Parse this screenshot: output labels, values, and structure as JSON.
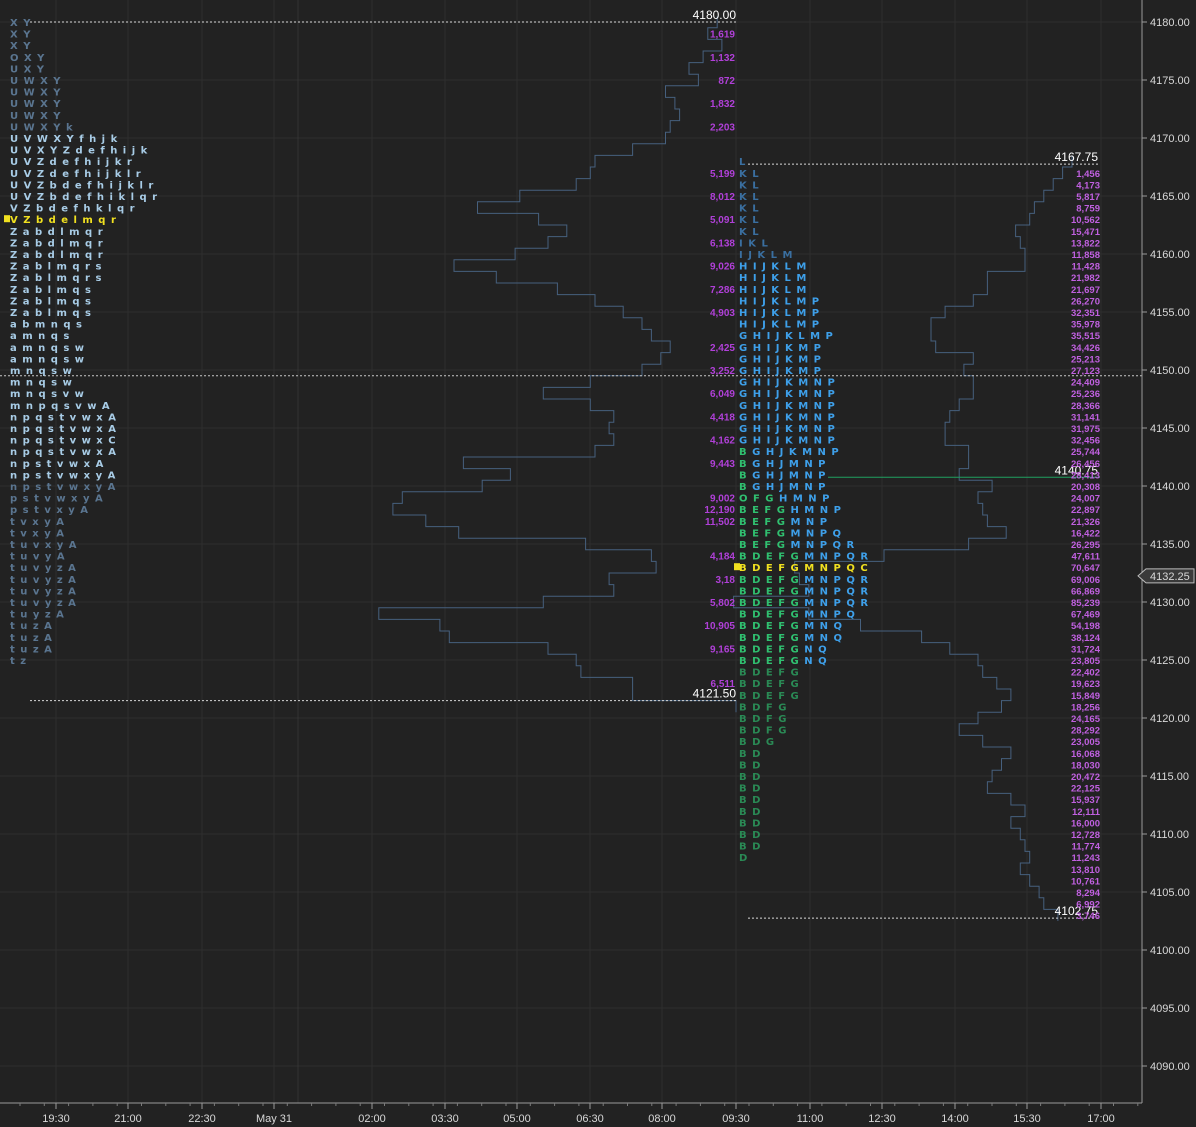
{
  "chart_data": {
    "type": "market-profile",
    "y_axis": {
      "range": [
        4086,
        4182
      ],
      "ticks": [
        "4180.00",
        "4175.00",
        "4170.00",
        "4165.00",
        "4160.00",
        "4155.00",
        "4150.00",
        "4145.00",
        "4140.00",
        "4135.00",
        "4130.00",
        "4125.00",
        "4120.00",
        "4115.00",
        "4110.00",
        "4105.00",
        "4100.00",
        "4095.00",
        "4090.00"
      ]
    },
    "x_axis": {
      "ticks": [
        "19:30",
        "21:00",
        "22:30",
        "May 31",
        "02:00",
        "03:30",
        "05:00",
        "06:30",
        "08:00",
        "09:30",
        "11:00",
        "12:30",
        "14:00",
        "15:30",
        "17:00"
      ]
    },
    "current_price": "4132.25",
    "grid": true,
    "levels": [
      {
        "label": "4180.00",
        "price": 4180.0,
        "session": "overnight"
      },
      {
        "label": "4121.50",
        "price": 4121.5,
        "session": "overnight"
      },
      {
        "label": "4167.75",
        "price": 4167.75,
        "session": "rth"
      },
      {
        "label": "4102.75",
        "price": 4102.75,
        "session": "rth"
      },
      {
        "label": "4140.75",
        "price": 4140.75,
        "session": "rth-poc"
      }
    ],
    "overnight_tpo": {
      "start_price": 4180.0,
      "step": 1.0,
      "poc_index": 17,
      "rows": [
        "X Y",
        "X Y",
        "X Y",
        "O X Y",
        "U X Y",
        "U W X Y",
        "U W X Y",
        "U W X Y",
        "U W X Y",
        "U W X Y k",
        "U V W X Y f h j k",
        "U V X Y Z d e f h i j k",
        "U V Z d e f h i j k r",
        "U V Z d e f h i j k l r",
        "U V Z b d e f h i j k l r",
        "U V Z b d e f h i k l q r",
        "V Z b d e f h k l q r",
        "V Z b d e l m q r",
        "Z a b d l m q r",
        "Z a b d l m q r",
        "Z a b d l m q r",
        "Z a b l m q r s",
        "Z a b l m q r s",
        "Z a b l m q s",
        "Z a b l m q s",
        "Z a b l m q s",
        "a b m n q s",
        "a m n q s",
        "a m n q s w",
        "a m n q s w",
        "m n q s w",
        "m n q s w",
        "m n q s v w",
        "m n p q s v w A",
        "n p q s t v w x A",
        "n p q s t v w x A",
        "n p q s t v w x C",
        "n p q s t v w x A",
        "n p s t v w x A",
        "n p s t v w x y A",
        "n p s t v w x y A",
        "p s t v w x y A",
        "p s t v x y A",
        "t v x y A",
        "t v x y A",
        "t u v x y A",
        "t u v y A",
        "t u v y z A",
        "t u v y z A",
        "t u v y z A",
        "t u v y z A",
        "t u y z A",
        "t u z A",
        "t u z A",
        "t u z A",
        "t z"
      ]
    },
    "overnight_volumes": [
      {
        "price": 4179.0,
        "value": "1,619"
      },
      {
        "price": 4177.0,
        "value": "1,132"
      },
      {
        "price": 4175.0,
        "value": "872"
      },
      {
        "price": 4173.0,
        "value": "1,832"
      },
      {
        "price": 4171.0,
        "value": "2,203"
      },
      {
        "price": 4167.0,
        "value": "5,199"
      },
      {
        "price": 4165.0,
        "value": "8,012"
      },
      {
        "price": 4163.0,
        "value": "5,091"
      },
      {
        "price": 4161.0,
        "value": "6,138"
      },
      {
        "price": 4159.0,
        "value": "9,026"
      },
      {
        "price": 4157.0,
        "value": "7,286"
      },
      {
        "price": 4155.0,
        "value": "4,903"
      },
      {
        "price": 4152.0,
        "value": "2,425"
      },
      {
        "price": 4150.0,
        "value": "3,252"
      },
      {
        "price": 4148.0,
        "value": "6,049"
      },
      {
        "price": 4146.0,
        "value": "4,418"
      },
      {
        "price": 4144.0,
        "value": "4,162"
      },
      {
        "price": 4142.0,
        "value": "9,443"
      },
      {
        "price": 4139.0,
        "value": "9,002"
      },
      {
        "price": 4138.0,
        "value": "12,190"
      },
      {
        "price": 4137.0,
        "value": "11,502"
      },
      {
        "price": 4134.0,
        "value": "4,184"
      },
      {
        "price": 4132.0,
        "value": "3,18"
      },
      {
        "price": 4130.0,
        "value": "5,802"
      },
      {
        "price": 4128.0,
        "value": "10,905"
      },
      {
        "price": 4126.0,
        "value": "9,165"
      },
      {
        "price": 4123.0,
        "value": "6,511"
      }
    ],
    "overnight_histogram": [
      [
        4180,
        4
      ],
      [
        4179,
        6
      ],
      [
        4178,
        3
      ],
      [
        4177,
        7
      ],
      [
        4176,
        10
      ],
      [
        4175,
        8
      ],
      [
        4174,
        15
      ],
      [
        4173,
        13
      ],
      [
        4172,
        12
      ],
      [
        4171,
        14
      ],
      [
        4170,
        15
      ],
      [
        4169,
        22
      ],
      [
        4168,
        30
      ],
      [
        4167,
        31
      ],
      [
        4166,
        34
      ],
      [
        4165,
        46
      ],
      [
        4164,
        55
      ],
      [
        4163,
        42
      ],
      [
        4162,
        36
      ],
      [
        4161,
        40
      ],
      [
        4160,
        47
      ],
      [
        4159,
        60
      ],
      [
        4158,
        51
      ],
      [
        4157,
        38
      ],
      [
        4156,
        30
      ],
      [
        4155,
        24
      ],
      [
        4154,
        20
      ],
      [
        4153,
        18
      ],
      [
        4152,
        14
      ],
      [
        4151,
        16
      ],
      [
        4150,
        20
      ],
      [
        4149,
        31
      ],
      [
        4148,
        41
      ],
      [
        4147,
        31
      ],
      [
        4146,
        26
      ],
      [
        4145,
        27
      ],
      [
        4144,
        26
      ],
      [
        4143,
        30
      ],
      [
        4142,
        58
      ],
      [
        4141,
        48
      ],
      [
        4140,
        54
      ],
      [
        4139,
        71
      ],
      [
        4138,
        73
      ],
      [
        4137,
        66
      ],
      [
        4136,
        59
      ],
      [
        4135,
        32
      ],
      [
        4134,
        18
      ],
      [
        4133,
        17
      ],
      [
        4132,
        27
      ],
      [
        4131,
        26
      ],
      [
        4130,
        41
      ],
      [
        4129,
        76
      ],
      [
        4128,
        63
      ],
      [
        4127,
        61
      ],
      [
        4126,
        40
      ],
      [
        4125,
        34
      ],
      [
        4124,
        33
      ],
      [
        4123,
        22
      ],
      [
        4122,
        22
      ],
      [
        4121,
        0
      ]
    ],
    "rth_tpo": {
      "start_price": 4168.0,
      "step": 1.0,
      "poc_index": 35,
      "rows": [
        "L",
        "K L",
        "K L",
        "K L",
        "K L",
        "K L",
        "K L",
        "I K L",
        "I J K L M",
        "H I J K L M",
        "H I J K L M",
        "H I J K L M",
        "H I J K L M P",
        "H I J K L M P",
        "H I J K L M P",
        "G H I J K L M P",
        "G H I J K M P",
        "G H I J K M P",
        "G H I J K M P",
        "G H I J K M N P",
        "G H I J K M N P",
        "G H I J K M N P",
        "G H I J K M N P",
        "G H I J K M N P",
        "G H I J K M N P",
        "B G H J K M N P",
        "B G H J M N P",
        "B G H J M N P",
        "B G H J M N P",
        "O F G H M N P",
        "B E F G H M N P",
        "B E F G M N P",
        "B E F G M N P Q",
        "B E F G M N P Q R",
        "B D E F G M N P Q R",
        "B D E F G M N P Q C",
        "B D E F G M N P Q R",
        "B D E F G M N P Q R",
        "B D E F G M N P Q R",
        "B D E F G M N P Q",
        "B D E F G M N Q",
        "B D E F G M N Q",
        "B D E F G N Q",
        "B D E F G N Q",
        "B D E F G",
        "B D E F G",
        "B D E F G",
        "B D F G",
        "B D F G",
        "B D F G",
        "B D G",
        "B D",
        "B D",
        "B D",
        "B D",
        "B D",
        "B D",
        "B D",
        "B D",
        "B D",
        "D"
      ]
    },
    "rth_volumes": [
      "1,456",
      "4,173",
      "5,817",
      "8,759",
      "10,562",
      "15,471",
      "13,822",
      "11,858",
      "11,428",
      "21,982",
      "21,697",
      "26,270",
      "32,351",
      "35,978",
      "35,515",
      "34,426",
      "25,213",
      "27,123",
      "24,409",
      "25,236",
      "28,366",
      "31,141",
      "31,975",
      "32,456",
      "25,744",
      "26,456",
      "28,413",
      "20,308",
      "24,007",
      "22,897",
      "21,326",
      "16,422",
      "26,295",
      "47,611",
      "70,647",
      "69,006",
      "66,869",
      "85,239",
      "67,469",
      "54,198",
      "38,124",
      "31,724",
      "23,805",
      "22,402",
      "19,623",
      "15,849",
      "18,256",
      "24,165",
      "28,292",
      "23,005",
      "16,068",
      "18,030",
      "20,472",
      "22,125",
      "15,937",
      "12,111",
      "16,000",
      "12,728",
      "11,774",
      "11,243",
      "13,810",
      "10,761",
      "8,294",
      "6,992",
      "3,746"
    ],
    "rth_histogram": [
      [
        4168,
        0
      ],
      [
        4167,
        2
      ],
      [
        4166,
        4
      ],
      [
        4165,
        6
      ],
      [
        4164,
        8
      ],
      [
        4163,
        9
      ],
      [
        4162,
        12
      ],
      [
        4161,
        11
      ],
      [
        4160,
        10
      ],
      [
        4159,
        10
      ],
      [
        4158,
        18
      ],
      [
        4157,
        18
      ],
      [
        4156,
        21
      ],
      [
        4155,
        27
      ],
      [
        4154,
        30
      ],
      [
        4153,
        30
      ],
      [
        4152,
        29
      ],
      [
        4151,
        21
      ],
      [
        4150,
        23
      ],
      [
        4149,
        21
      ],
      [
        4148,
        21
      ],
      [
        4147,
        24
      ],
      [
        4146,
        26
      ],
      [
        4145,
        27
      ],
      [
        4144,
        27
      ],
      [
        4143,
        22
      ],
      [
        4142,
        22
      ],
      [
        4141,
        24
      ],
      [
        4140,
        17
      ],
      [
        4139,
        20
      ],
      [
        4138,
        19
      ],
      [
        4137,
        18
      ],
      [
        4136,
        14
      ],
      [
        4135,
        22
      ],
      [
        4134,
        40
      ],
      [
        4133,
        59
      ],
      [
        4132,
        58
      ],
      [
        4131,
        56
      ],
      [
        4130,
        72
      ],
      [
        4129,
        56
      ],
      [
        4128,
        45
      ],
      [
        4127,
        32
      ],
      [
        4126,
        26
      ],
      [
        4125,
        20
      ],
      [
        4124,
        19
      ],
      [
        4123,
        16
      ],
      [
        4122,
        13
      ],
      [
        4121,
        15
      ],
      [
        4120,
        20
      ],
      [
        4119,
        24
      ],
      [
        4118,
        19
      ],
      [
        4117,
        13
      ],
      [
        4116,
        15
      ],
      [
        4115,
        17
      ],
      [
        4114,
        18
      ],
      [
        4113,
        13
      ],
      [
        4112,
        10
      ],
      [
        4111,
        13
      ],
      [
        4110,
        11
      ],
      [
        4109,
        10
      ],
      [
        4108,
        9
      ],
      [
        4107,
        11
      ],
      [
        4106,
        9
      ],
      [
        4105,
        7
      ],
      [
        4104,
        6
      ],
      [
        4103,
        3
      ]
    ]
  }
}
